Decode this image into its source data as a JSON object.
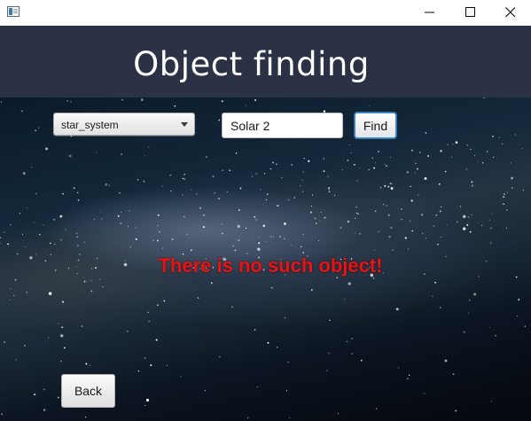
{
  "window": {
    "icons": {
      "app": "app-window-icon",
      "minimize": "minimize-icon",
      "maximize": "maximize-icon",
      "close": "close-icon"
    }
  },
  "header": {
    "title": "Object finding",
    "background_color": "#2c3245"
  },
  "search": {
    "type_select": {
      "selected": "star_system"
    },
    "query": {
      "value": "Solar 2"
    },
    "find_label": "Find"
  },
  "result": {
    "message": "There is no such object!",
    "color": "#ee1111"
  },
  "footer": {
    "back_label": "Back"
  }
}
